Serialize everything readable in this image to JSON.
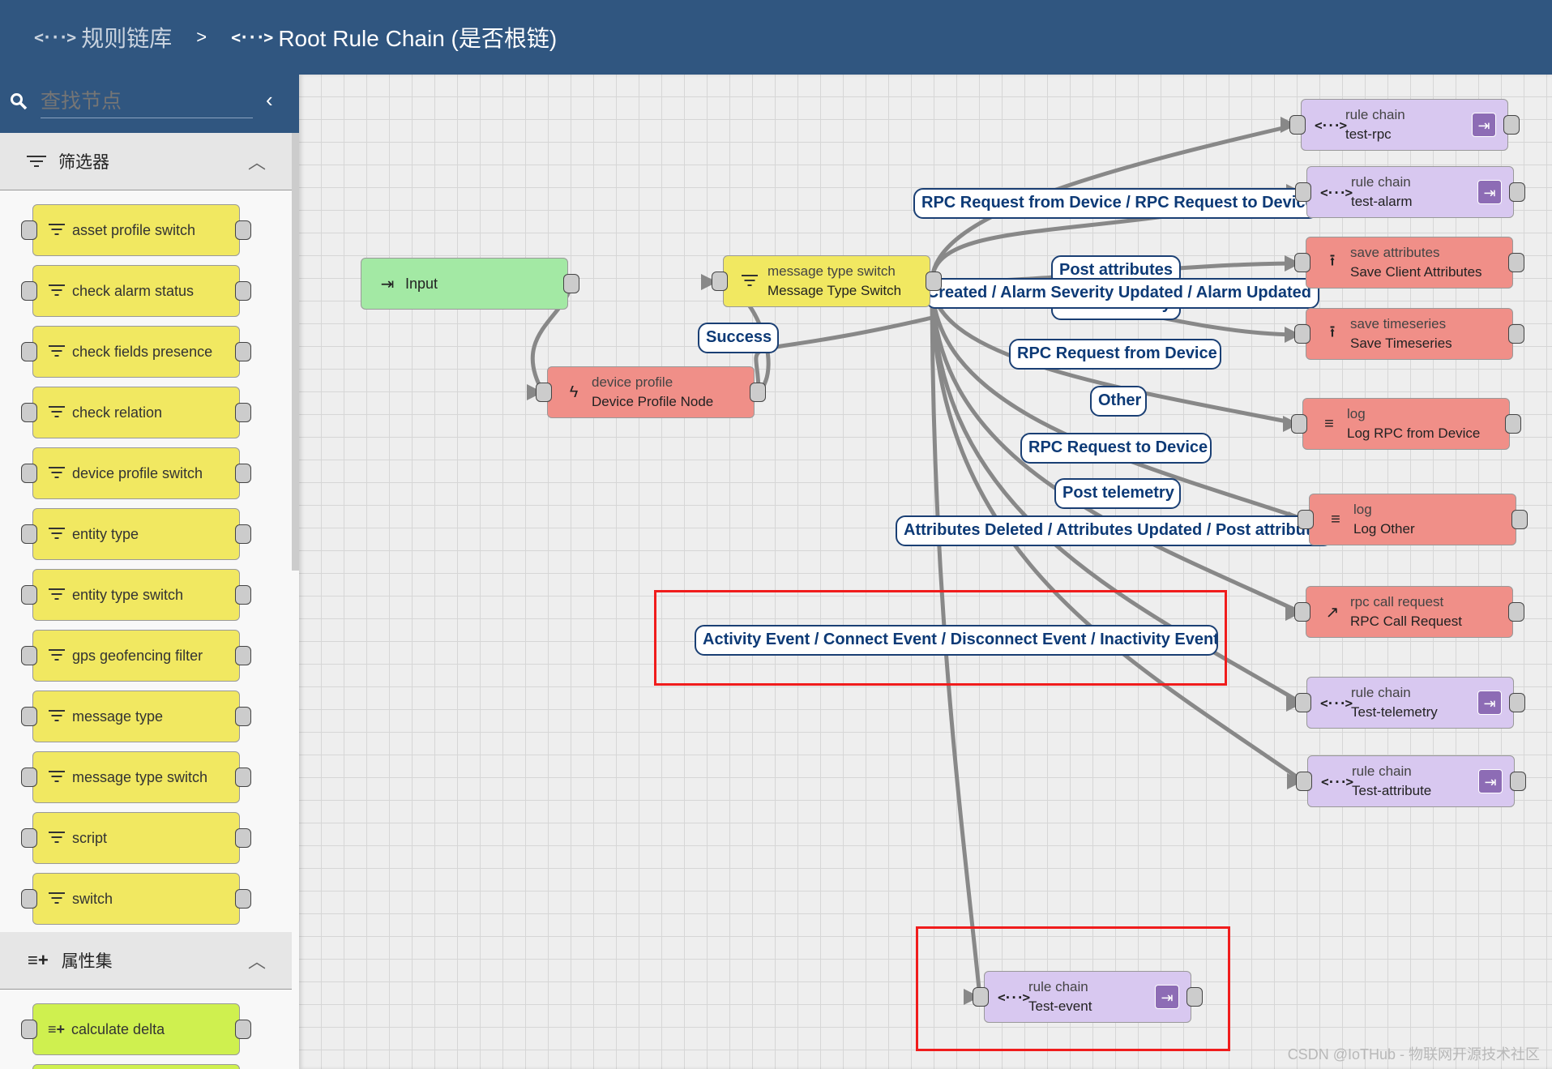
{
  "header": {
    "breadcrumb": [
      {
        "label": "规则链库",
        "icon": "rule-chain-icon"
      },
      {
        "label": "Root Rule Chain (是否根链)",
        "icon": "rule-chain-icon"
      }
    ],
    "separator": ">"
  },
  "sidebar": {
    "search": {
      "placeholder": "查找节点"
    },
    "sections": [
      {
        "title": "筛选器",
        "icon": "filter-icon",
        "expanded": true,
        "items": [
          "asset profile switch",
          "check alarm status",
          "check fields presence",
          "check relation",
          "device profile switch",
          "entity type",
          "entity type switch",
          "gps geofencing filter",
          "message type",
          "message type switch",
          "script",
          "switch"
        ]
      },
      {
        "title": "属性集",
        "icon": "playlist-add-icon",
        "expanded": true,
        "items": [
          "calculate delta",
          ""
        ]
      }
    ]
  },
  "canvas": {
    "nodes": [
      {
        "type": "",
        "name": "Input",
        "color": "#a3e9a4",
        "icon": "input-icon"
      },
      {
        "type": "device profile",
        "name": "Device Profile Node",
        "color": "#f08f88",
        "icon": "lightning-icon"
      },
      {
        "type": "message type switch",
        "name": "Message Type Switch",
        "color": "#f1e861",
        "icon": "filter-icon"
      },
      {
        "type": "rule chain",
        "name": "test-rpc",
        "color": "#d8c8f0",
        "icon": "rule-chain-icon"
      },
      {
        "type": "rule chain",
        "name": "test-alarm",
        "color": "#d8c8f0",
        "icon": "rule-chain-icon"
      },
      {
        "type": "save attributes",
        "name": "Save Client Attributes",
        "color": "#f08f88",
        "icon": "upload-icon"
      },
      {
        "type": "save timeseries",
        "name": "Save Timeseries",
        "color": "#f08f88",
        "icon": "upload-icon"
      },
      {
        "type": "log",
        "name": "Log RPC from Device",
        "color": "#f08f88",
        "icon": "menu-icon"
      },
      {
        "type": "log",
        "name": "Log Other",
        "color": "#f08f88",
        "icon": "menu-icon"
      },
      {
        "type": "rpc call request",
        "name": "RPC Call Request",
        "color": "#f08f88",
        "icon": "arrow-up-right-icon"
      },
      {
        "type": "rule chain",
        "name": "Test-telemetry",
        "color": "#d8c8f0",
        "icon": "rule-chain-icon"
      },
      {
        "type": "rule chain",
        "name": "Test-attribute",
        "color": "#d8c8f0",
        "icon": "rule-chain-icon"
      },
      {
        "type": "rule chain",
        "name": "Test-event",
        "color": "#d8c8f0",
        "icon": "rule-chain-icon"
      }
    ],
    "links": [
      "RPC Request from Device / RPC Request to Device",
      "Post attributes",
      "Post telemetry",
      "Created / Alarm Severity Updated / Alarm Updated",
      "Success",
      "RPC Request from Device",
      "Other",
      "RPC Request to Device",
      "Post telemetry",
      "Attributes Deleted / Attributes Updated / Post attributes",
      "Activity Event / Connect Event / Disconnect Event / Inactivity Event"
    ],
    "highlight_color": "#f01c1c"
  },
  "watermark": "CSDN @IoTHub - 物联网开源技术社区"
}
